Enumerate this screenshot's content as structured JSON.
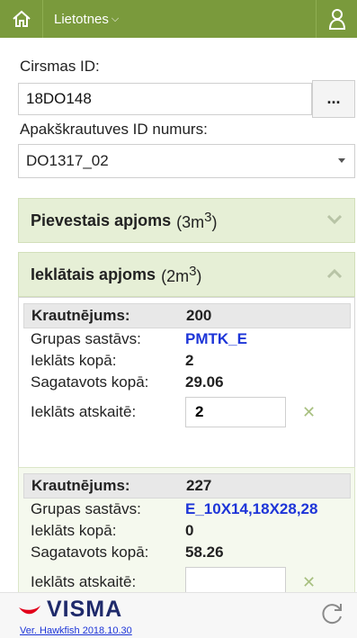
{
  "topbar": {
    "apps_label": "Lietotnes",
    "colors": {
      "bar": "#7a9a3c",
      "icon": "#ffffff"
    },
    "home_icon": "home-icon",
    "user_icon": "user-icon"
  },
  "form": {
    "cirsmas_label": "Cirsmas ID:",
    "cirsmas_value": "18DO148",
    "lookup_button": "...",
    "apakskrautuves_label": "Apakškrautuves ID numurs:",
    "apakskrautuves_value": "DO1317_02"
  },
  "panels": {
    "pievestais": {
      "title": "Pievestais apjoms",
      "amount": "(3m",
      "sup": "3",
      "close": ")"
    },
    "ieklatais": {
      "title": "Ieklātais apjoms",
      "amount": "(2m",
      "sup": "3",
      "close": ")"
    }
  },
  "cards": [
    {
      "krautnejums_label": "Krautnējums:",
      "krautnejums_value": "200",
      "grupas_label": "Grupas sastāvs:",
      "grupas_value": "PMTK_E",
      "ieklats_label": "Ieklāts kopā:",
      "ieklats_value": "2",
      "sagatavots_label": "Sagatavots kopā:",
      "sagatavots_value": "29.06",
      "atskaite_label": "Ieklāts atskaitē:",
      "atskaite_value": "2"
    },
    {
      "krautnejums_label": "Krautnējums:",
      "krautnejums_value": "227",
      "grupas_label": "Grupas sastāvs:",
      "grupas_value": "E_10X14,18X28,28",
      "ieklats_label": "Ieklāts kopā:",
      "ieklats_value": "0",
      "sagatavots_label": "Sagatavots kopā:",
      "sagatavots_value": "58.26",
      "atskaite_label": "Ieklāts atskaitē:",
      "atskaite_value": ""
    }
  ],
  "footer": {
    "brand": "VISMA",
    "version": "Ver. Hawkfish 2018.10.30",
    "colors": {
      "brand_red": "#e2001a",
      "brand_navy": "#1f2a6b"
    }
  }
}
